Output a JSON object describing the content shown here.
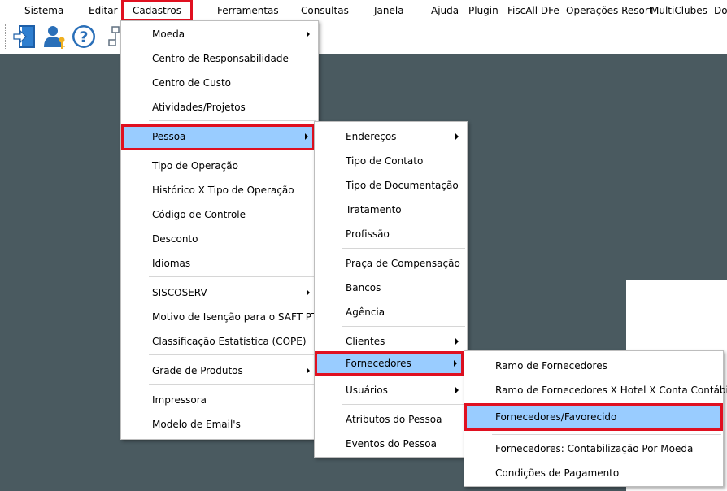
{
  "menubar": {
    "items": [
      "Sistema",
      "Editar",
      "Cadastros",
      "Ferramentas",
      "Consultas",
      "Janela",
      "Ajuda",
      "Plugin",
      "FiscAll DFe",
      "Operações Resort",
      "MultiClubes",
      "Do"
    ]
  },
  "toolbar": {
    "buttons": [
      "exit-door-icon",
      "user-key-icon",
      "help-question-icon",
      "network-icon"
    ]
  },
  "menu_cadastros": {
    "items": [
      "Moeda",
      "Centro de Responsabilidade",
      "Centro de Custo",
      "Atividades/Projetos",
      "Pessoa",
      "Tipo de Operação",
      "Histórico  X Tipo de Operação",
      "Código de Controle",
      "Desconto",
      "Idiomas",
      "SISCOSERV",
      "Motivo de Isenção para o SAFT PT",
      "Classificação Estatística (COPE)",
      "Grade de Produtos",
      "Impressora",
      "Modelo de Email's"
    ]
  },
  "menu_pessoa": {
    "items": [
      "Endereços",
      "Tipo de Contato",
      "Tipo de Documentação",
      "Tratamento",
      "Profissão",
      "Praça de Compensação",
      "Bancos",
      "Agência",
      "Clientes",
      "Fornecedores",
      "Usuários",
      "Atributos do Pessoa",
      "Eventos do Pessoa"
    ]
  },
  "menu_fornecedores": {
    "items": [
      "Ramo de Fornecedores",
      "Ramo de Fornecedores X Hotel X Conta Contábil",
      "Fornecedores/Favorecido",
      "Fornecedores: Contabilização Por Moeda",
      "Condições de Pagamento"
    ]
  },
  "colors": {
    "highlight": "#99ccff",
    "annotation_red": "#e01020",
    "workspace": "#4a5a60"
  }
}
